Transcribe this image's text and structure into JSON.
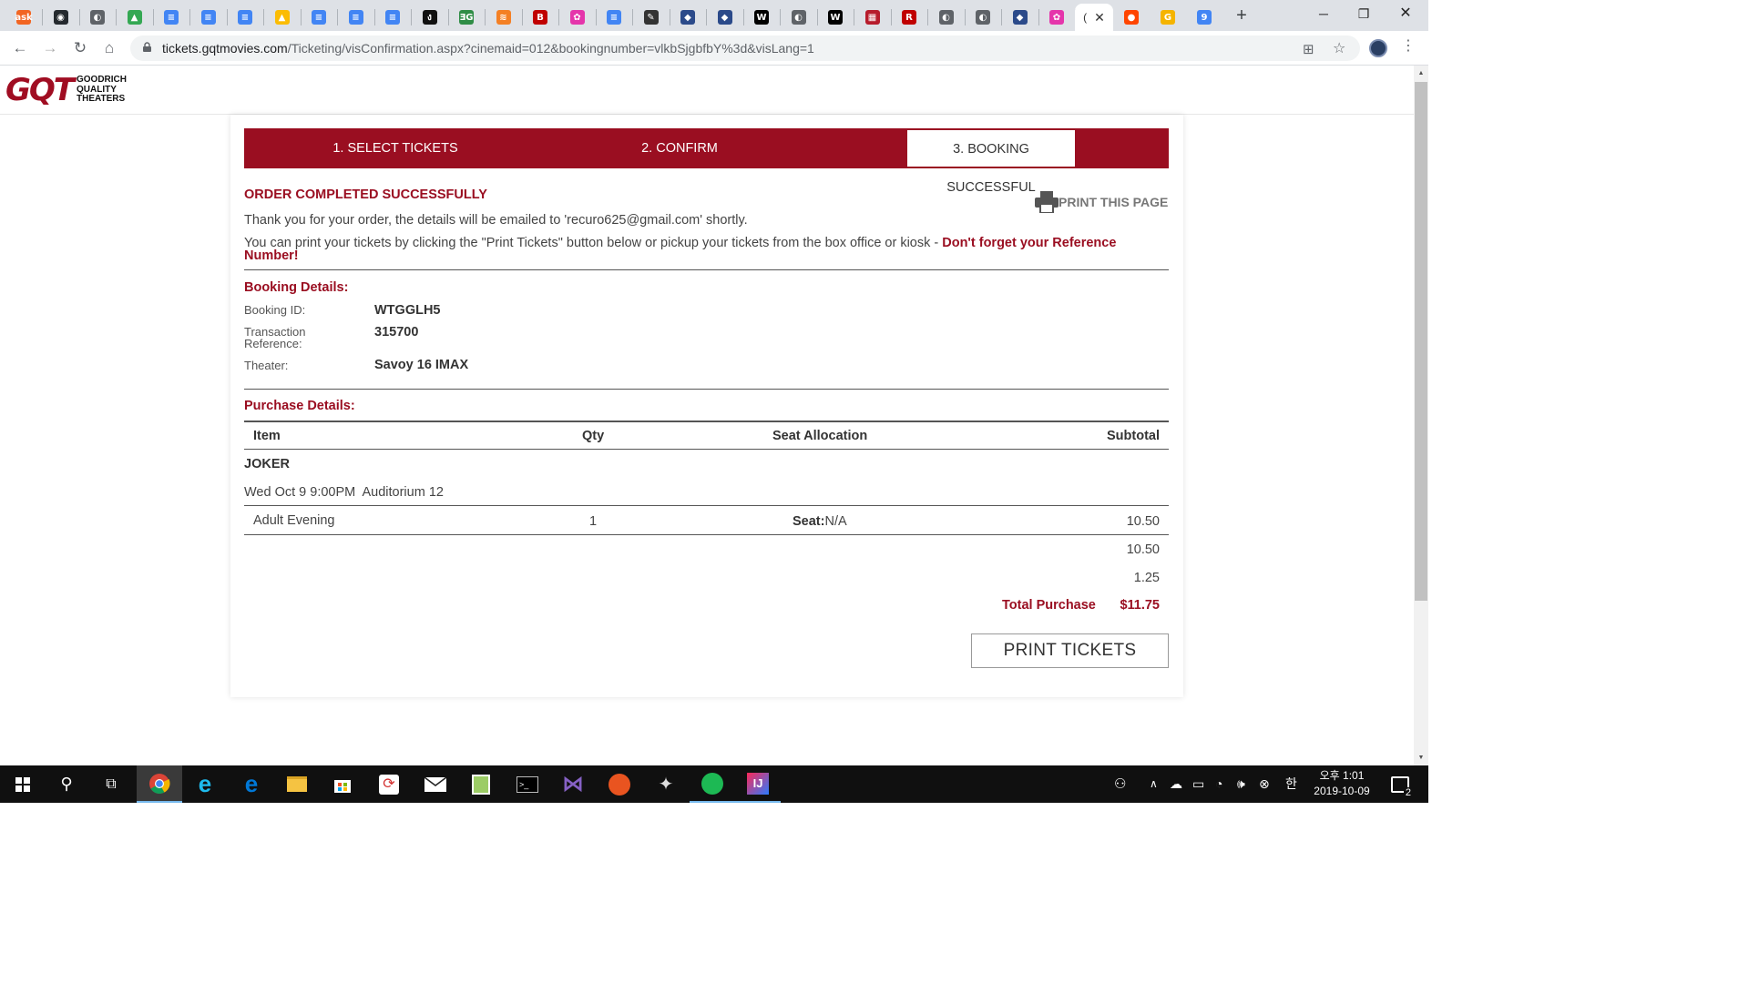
{
  "browser": {
    "url_host": "tickets.gqtmovies.com",
    "url_path": "/Ticketing/visConfirmation.aspx?cinemaid=012&bookingnumber=vlkbSjgbfbY%3d&visLang=1",
    "active_tab_title": "(",
    "tabs": [
      {
        "icon": "ask-icon",
        "color": "#f26522",
        "glyph": "ask"
      },
      {
        "icon": "github-icon",
        "color": "#24292e",
        "glyph": "◉"
      },
      {
        "icon": "globe-icon",
        "color": "#5f6368",
        "glyph": "◐"
      },
      {
        "icon": "google-drive-icon",
        "color": "#34a853",
        "glyph": "▲"
      },
      {
        "icon": "google-docs-icon",
        "color": "#4285f4",
        "glyph": "≡"
      },
      {
        "icon": "google-docs-icon",
        "color": "#4285f4",
        "glyph": "≡"
      },
      {
        "icon": "google-docs-icon",
        "color": "#4285f4",
        "glyph": "≡"
      },
      {
        "icon": "google-drive-icon",
        "color": "#fbbc04",
        "glyph": "▲"
      },
      {
        "icon": "google-docs-icon",
        "color": "#4285f4",
        "glyph": "≡"
      },
      {
        "icon": "google-docs-icon",
        "color": "#4285f4",
        "glyph": "≡"
      },
      {
        "icon": "google-docs-icon",
        "color": "#4285f4",
        "glyph": "≡"
      },
      {
        "icon": "swirl-icon",
        "color": "#111111",
        "glyph": "ง"
      },
      {
        "icon": "geeksforgeeks-icon",
        "color": "#2f8d46",
        "glyph": "ƎG"
      },
      {
        "icon": "stack-overflow-icon",
        "color": "#f48024",
        "glyph": "≋"
      },
      {
        "icon": "b-icon",
        "color": "#c00000",
        "glyph": "B"
      },
      {
        "icon": "graphql-icon",
        "color": "#e535ab",
        "glyph": "✿"
      },
      {
        "icon": "google-docs-icon",
        "color": "#4285f4",
        "glyph": "≡"
      },
      {
        "icon": "pen-icon",
        "color": "#333333",
        "glyph": "✎"
      },
      {
        "icon": "shield-icon",
        "color": "#2b4a8a",
        "glyph": "◆"
      },
      {
        "icon": "shield-icon",
        "color": "#2b4a8a",
        "glyph": "◆"
      },
      {
        "icon": "wikipedia-icon",
        "color": "#000000",
        "glyph": "W"
      },
      {
        "icon": "globe-icon",
        "color": "#5f6368",
        "glyph": "◐"
      },
      {
        "icon": "wikipedia-icon",
        "color": "#000000",
        "glyph": "W"
      },
      {
        "icon": "grid-icon",
        "color": "#b71c2c",
        "glyph": "▦"
      },
      {
        "icon": "r-icon",
        "color": "#c00000",
        "glyph": "R"
      },
      {
        "icon": "globe-icon",
        "color": "#5f6368",
        "glyph": "◐"
      },
      {
        "icon": "globe-icon",
        "color": "#5f6368",
        "glyph": "◐"
      },
      {
        "icon": "shield-icon",
        "color": "#2b4a8a",
        "glyph": "◆"
      },
      {
        "icon": "graphql-icon",
        "color": "#e535ab",
        "glyph": "✿"
      }
    ],
    "tabs_after": [
      {
        "icon": "reddit-icon",
        "color": "#ff4500",
        "glyph": "●"
      },
      {
        "icon": "grammarly-icon",
        "color": "#f5b400",
        "glyph": "G"
      },
      {
        "icon": "calendar-icon",
        "color": "#4285f4",
        "glyph": "9"
      }
    ]
  },
  "site": {
    "logo_mark": "GQT",
    "logo_line1": "GOODRICH",
    "logo_line2": "QUALITY",
    "logo_line3": "THEATERS"
  },
  "steps": {
    "step1": "1. SELECT TICKETS",
    "step2": "2. CONFIRM",
    "step3": "3. BOOKING SUCCESSFUL"
  },
  "order": {
    "heading": "ORDER COMPLETED SUCCESSFULLY",
    "print_page": "PRINT THIS PAGE",
    "thanks": "Thank you for your order, the details will be emailed to 'recuro625@gmail.com' shortly.",
    "print_info": "You can print your tickets by clicking the \"Print Tickets\" button below or pickup your tickets from the box office or kiosk - ",
    "reminder_a": "Don't forget your Reference",
    "reminder_b": "Number!"
  },
  "booking": {
    "heading": "Booking Details:",
    "id_label": "Booking ID:",
    "id_value": "WTGGLH5",
    "ref_label_a": "Transaction",
    "ref_label_b": "Reference:",
    "ref_value": "315700",
    "theater_label": "Theater:",
    "theater_value": "Savoy 16 IMAX"
  },
  "purchase": {
    "heading": "Purchase Details:",
    "col_item": "Item",
    "col_qty": "Qty",
    "col_seat": "Seat Allocation",
    "col_subtotal": "Subtotal",
    "movie": "JOKER",
    "showtime": "Wed Oct 9 9:00PM  Auditorium 12",
    "line_item": "Adult Evening",
    "line_qty": "1",
    "seat_label": "Seat:",
    "seat_value": "N/A",
    "line_subtotal": "10.50",
    "subtotal": "10.50",
    "fee": "1.25",
    "total_label": "Total Purchase",
    "total_value": "$11.75",
    "print_button": "PRINT TICKETS"
  },
  "taskbar": {
    "ime": "한",
    "clock_time": "오후 1:01",
    "clock_date": "2019-10-09",
    "notifications": "2"
  },
  "colors": {
    "brand": "#9a0e21"
  }
}
